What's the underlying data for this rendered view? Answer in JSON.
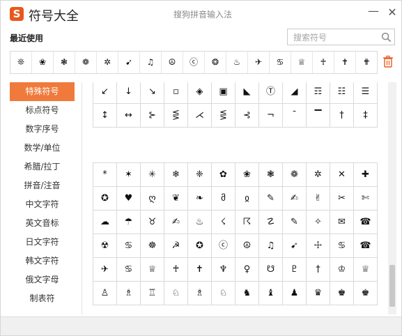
{
  "app": {
    "logo_letter": "S",
    "title": "符号大全",
    "subtitle": "搜狗拼音输入法",
    "minimize_glyph": "—",
    "close_glyph": "✕",
    "accent_color": "#f07a3c"
  },
  "recent": {
    "title": "最近使用",
    "items": [
      "❊",
      "❀",
      "❃",
      "❁",
      "✲",
      "➹",
      "♫",
      "☮",
      "ⓒ",
      "❂",
      "♨",
      "✈",
      "♋",
      "♕",
      "♰",
      "✝",
      "✟"
    ]
  },
  "search": {
    "placeholder": "搜索符号",
    "value": ""
  },
  "sidebar": {
    "items": [
      {
        "label": "特殊符号",
        "active": true
      },
      {
        "label": "标点符号",
        "active": false
      },
      {
        "label": "数字序号",
        "active": false
      },
      {
        "label": "数学/单位",
        "active": false
      },
      {
        "label": "希腊/拉丁",
        "active": false
      },
      {
        "label": "拼音/注音",
        "active": false
      },
      {
        "label": "中文字符",
        "active": false
      },
      {
        "label": "英文音标",
        "active": false
      },
      {
        "label": "日文字符",
        "active": false
      },
      {
        "label": "韩文字符",
        "active": false
      },
      {
        "label": "俄文字母",
        "active": false
      },
      {
        "label": "制表符",
        "active": false
      }
    ]
  },
  "grid_top": {
    "rows": [
      [
        "↙",
        "↓",
        "↘",
        "▫",
        "◈",
        "▣",
        "◣",
        "Ⓣ",
        "◢",
        "☶",
        "☷",
        "☰"
      ],
      [
        "↕",
        "↔",
        "⊱",
        "⋚",
        "⋌",
        "⋚",
        "⊰",
        "¬",
        "¯",
        "▔",
        "†",
        "‡"
      ]
    ]
  },
  "grid_main": {
    "rows": [
      [
        "*",
        "✶",
        "✳",
        "❄",
        "❈",
        "✿",
        "❀",
        "❃",
        "❁",
        "✲",
        "✕",
        "✚"
      ],
      [
        "✪",
        "♥",
        "ღ",
        "❦",
        "❧",
        "მ",
        "ჲ",
        "✎",
        "✍",
        "✌",
        "✂",
        "✄"
      ],
      [
        "☁",
        "☂",
        "♉",
        "✍",
        "♨",
        "☇",
        "☈",
        "☡",
        "✎",
        "✧",
        "✉",
        "☎"
      ],
      [
        "☢",
        "♋",
        "☸",
        "☭",
        "✪",
        "ⓒ",
        "☮",
        "♫",
        "➹",
        "☩",
        "♋",
        "☎"
      ],
      [
        "✈",
        "♋",
        "♕",
        "♰",
        "✝",
        "♆",
        "♀",
        "☋",
        "♇",
        "†",
        "♔",
        "♕"
      ],
      [
        "♙",
        "♗",
        "♖",
        "♘",
        "♗",
        "♘",
        "♞",
        "♝",
        "♟",
        "♛",
        "♚",
        "♚"
      ]
    ]
  }
}
